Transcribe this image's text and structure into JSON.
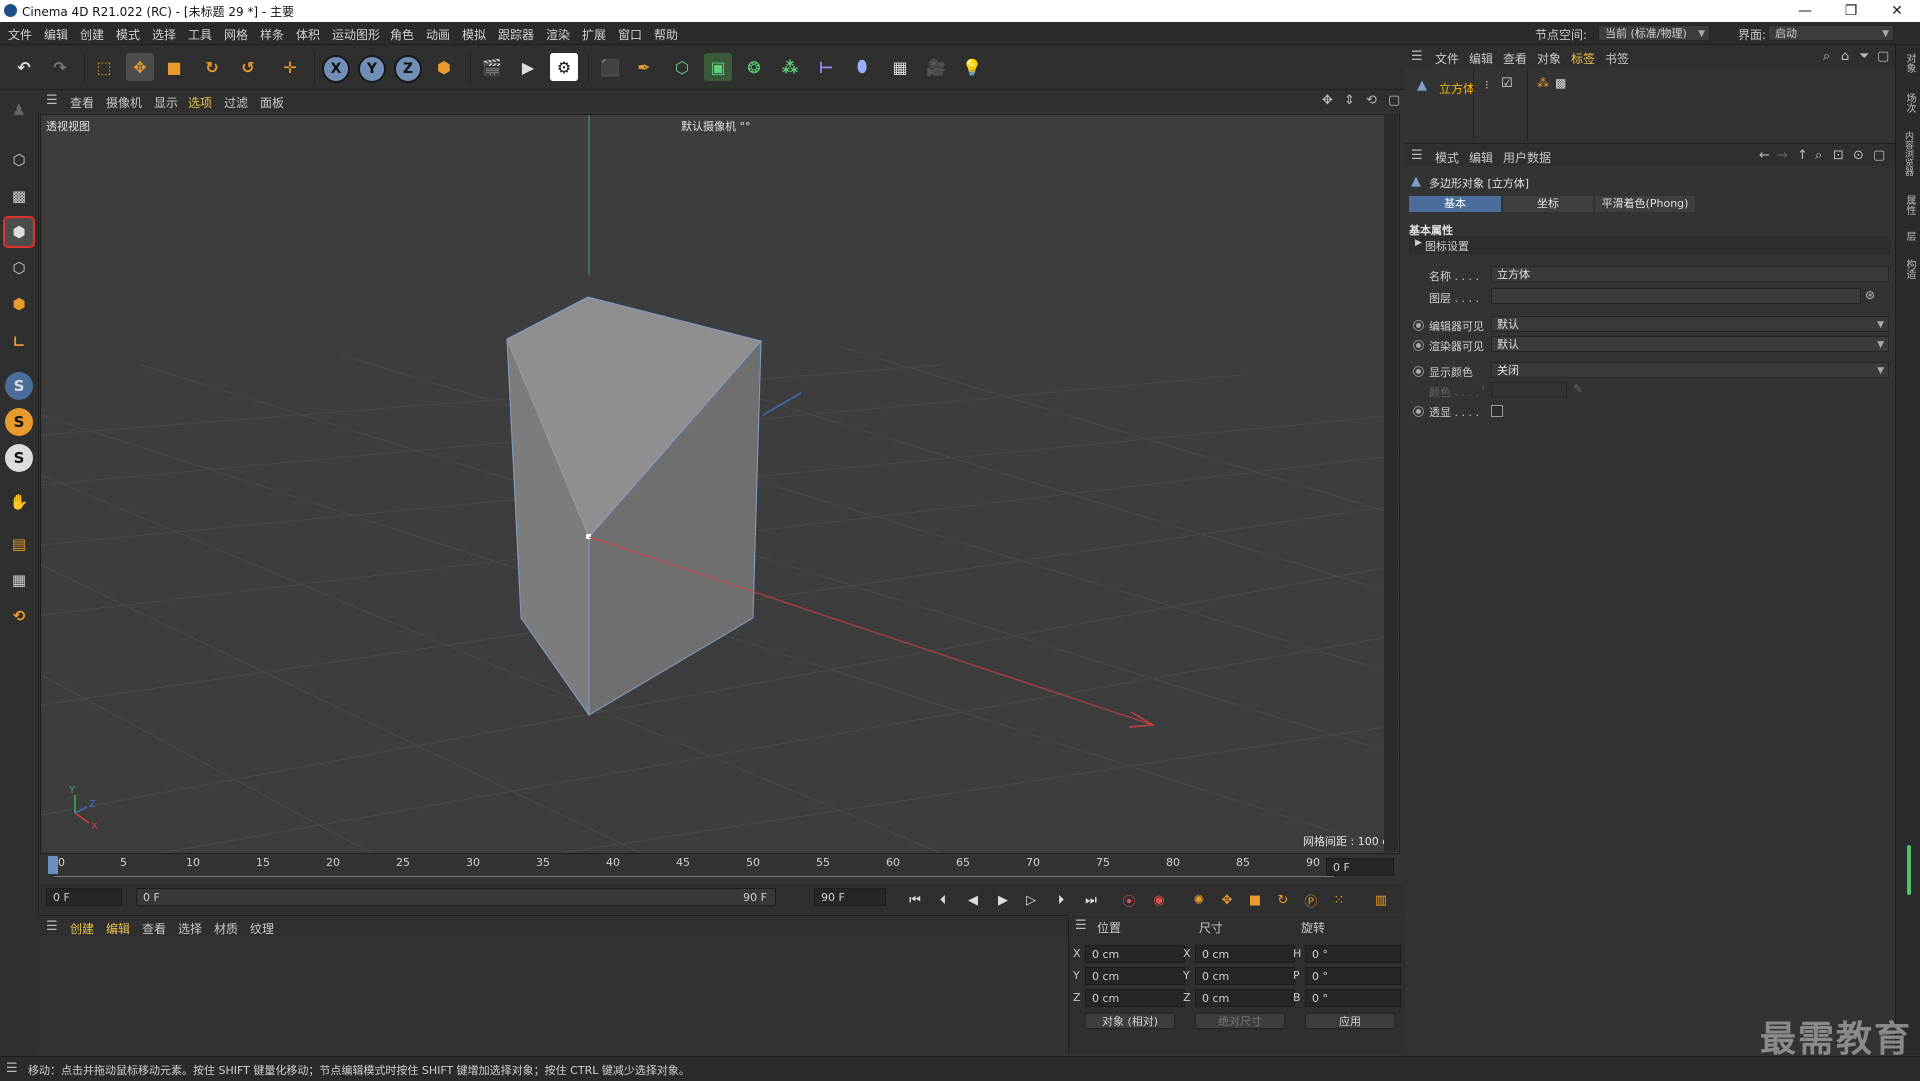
{
  "window": {
    "title": "Cinema 4D R21.022 (RC) - [未标题 29 *] - 主要",
    "minimize": "—",
    "restore": "❐",
    "close": "✕"
  },
  "menu": {
    "items": [
      "文件",
      "编辑",
      "创建",
      "模式",
      "选择",
      "工具",
      "网格",
      "样条",
      "体积",
      "运动图形",
      "角色",
      "动画",
      "模拟",
      "跟踪器",
      "渲染",
      "扩展",
      "窗口",
      "帮助"
    ],
    "node_space_label": "节点空间:",
    "node_space_value": "当前 (标准/物理)",
    "layout_label": "界面:",
    "layout_value": "启动"
  },
  "viewport": {
    "menu": [
      "查看",
      "摄像机",
      "显示",
      "选项",
      "过滤",
      "面板"
    ],
    "view_name": "透视视图",
    "camera_label": "默认摄像机 °°",
    "grid_spacing": "网格间距 : 100 cm",
    "point_mode_label": "点"
  },
  "timeline": {
    "ticks": [
      "0",
      "5",
      "10",
      "15",
      "20",
      "25",
      "30",
      "35",
      "40",
      "45",
      "50",
      "55",
      "60",
      "65",
      "70",
      "75",
      "80",
      "85",
      "90"
    ],
    "current_frame": "0 F",
    "start_frame": "0 F",
    "range_start": "0 F",
    "range_end": "90 F",
    "end_frame": "90 F"
  },
  "material_manager": {
    "menu": [
      "创建",
      "编辑",
      "查看",
      "选择",
      "材质",
      "纹理"
    ]
  },
  "coordinates": {
    "headers": {
      "position": "位置",
      "size": "尺寸",
      "rotation": "旋转"
    },
    "rows": [
      {
        "axis": "X",
        "pos": "0 cm",
        "size_axis": "X",
        "size": "0 cm",
        "rot_axis": "H",
        "rot": "0 °"
      },
      {
        "axis": "Y",
        "pos": "0 cm",
        "size_axis": "Y",
        "size": "0 cm",
        "rot_axis": "P",
        "rot": "0 °"
      },
      {
        "axis": "Z",
        "pos": "0 cm",
        "size_axis": "Z",
        "size": "0 cm",
        "rot_axis": "B",
        "rot": "0 °"
      }
    ],
    "mode": "对象 (相对)",
    "size_mode": "绝对尺寸",
    "apply": "应用"
  },
  "object_manager": {
    "menu": [
      "文件",
      "编辑",
      "查看",
      "对象",
      "标签",
      "书签"
    ],
    "object_name": "立方体"
  },
  "attribute_manager": {
    "menu": [
      "模式",
      "编辑",
      "用户数据"
    ],
    "object_title": "多边形对象 [立方体]",
    "tabs": [
      "基本",
      "坐标",
      "平滑着色(Phong)"
    ],
    "section": "基本属性",
    "subsection": "图标设置",
    "name_label": "名称 . . . .",
    "name_value": "立方体",
    "layer_label": "图层 . . . .",
    "editor_visible_label": "编辑器可见",
    "editor_visible_value": "默认",
    "render_visible_label": "渲染器可见",
    "render_visible_value": "默认",
    "display_color_label": "显示颜色",
    "display_color_value": "关闭",
    "color_label": "颜色 . . . .",
    "xray_label": "透显 . . . ."
  },
  "status": {
    "text": "移动：点击并拖动鼠标移动元素。按住 SHIFT 键量化移动；节点编辑模式时按住 SHIFT 键增加选择对象；按住 CTRL 键减少选择对象。"
  },
  "right_vtabs": [
    "对象",
    "场次",
    "内容浏览器",
    "属性",
    "层",
    "构造"
  ],
  "watermark": "最需教育",
  "colors": {
    "accent_blue": "#4a6d9b",
    "object_highlight": "#f5b400",
    "x_axis": "#c84040",
    "y_axis": "#40b060",
    "z_axis": "#4070c0"
  }
}
